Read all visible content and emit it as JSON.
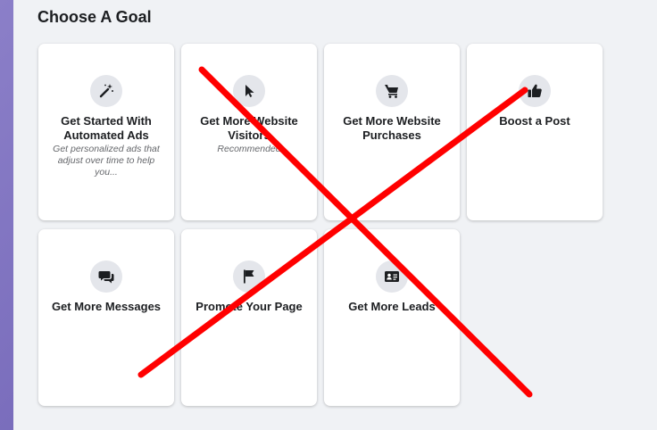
{
  "page": {
    "title": "Choose A Goal"
  },
  "goals": [
    {
      "label": "Get Started With Automated Ads",
      "sub": "Get personalized ads that adjust over time to help you...",
      "icon": "magic-wand-icon"
    },
    {
      "label": "Get More Website Visitors",
      "sub": "Recommended",
      "icon": "cursor-icon"
    },
    {
      "label": "Get More Website Purchases",
      "sub": "",
      "icon": "shopping-cart-icon"
    },
    {
      "label": "Boost a Post",
      "sub": "",
      "icon": "thumbs-up-icon"
    },
    {
      "label": "Get More Messages",
      "sub": "",
      "icon": "chat-bubbles-icon"
    },
    {
      "label": "Promote Your Page",
      "sub": "",
      "icon": "flag-icon"
    },
    {
      "label": "Get More Leads",
      "sub": "",
      "icon": "contact-card-icon"
    }
  ],
  "colors": {
    "panel_bg": "#f0f2f5",
    "card_bg": "#ffffff",
    "icon_bg": "#e4e6eb",
    "annotation_x": "#ff0000"
  }
}
